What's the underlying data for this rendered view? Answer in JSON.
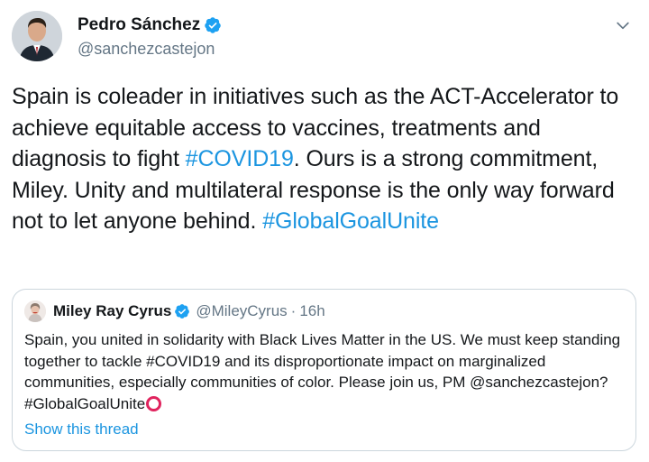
{
  "tweet": {
    "author_name": "Pedro Sánchez",
    "author_handle": "@sanchezcastejon",
    "text_parts": [
      "Spain is coleader in initiatives such as the ACT-Accelerator to achieve equitable access to vaccines, treatments and diagnosis to fight ",
      "#COVID19",
      ". Ours is a strong commitment, Miley. Unity and multilateral response is the only way forward not to let anyone behind. ",
      "#GlobalGoalUnite"
    ]
  },
  "quote": {
    "author_name": "Miley Ray Cyrus",
    "author_handle": "@MileyCyrus",
    "separator": "·",
    "time": "16h",
    "text": "Spain, you united in solidarity with Black Lives Matter in the US. We must keep standing together to tackle #COVID19 and its disproportionate impact on marginalized communities, especially communities of color. Please join us, PM @sanchezcastejon? #GlobalGoalUnite",
    "show_thread": "Show this thread"
  },
  "icons": {
    "verified": "verified-badge-icon",
    "caret": "chevron-down-icon",
    "emoji": "hollow-red-circle-emoji"
  },
  "colors": {
    "link": "#1b95e0",
    "verified": "#1da1f2",
    "secondary_text": "#657786",
    "border": "#ccd6dd",
    "emoji_red": "#e0245e"
  }
}
